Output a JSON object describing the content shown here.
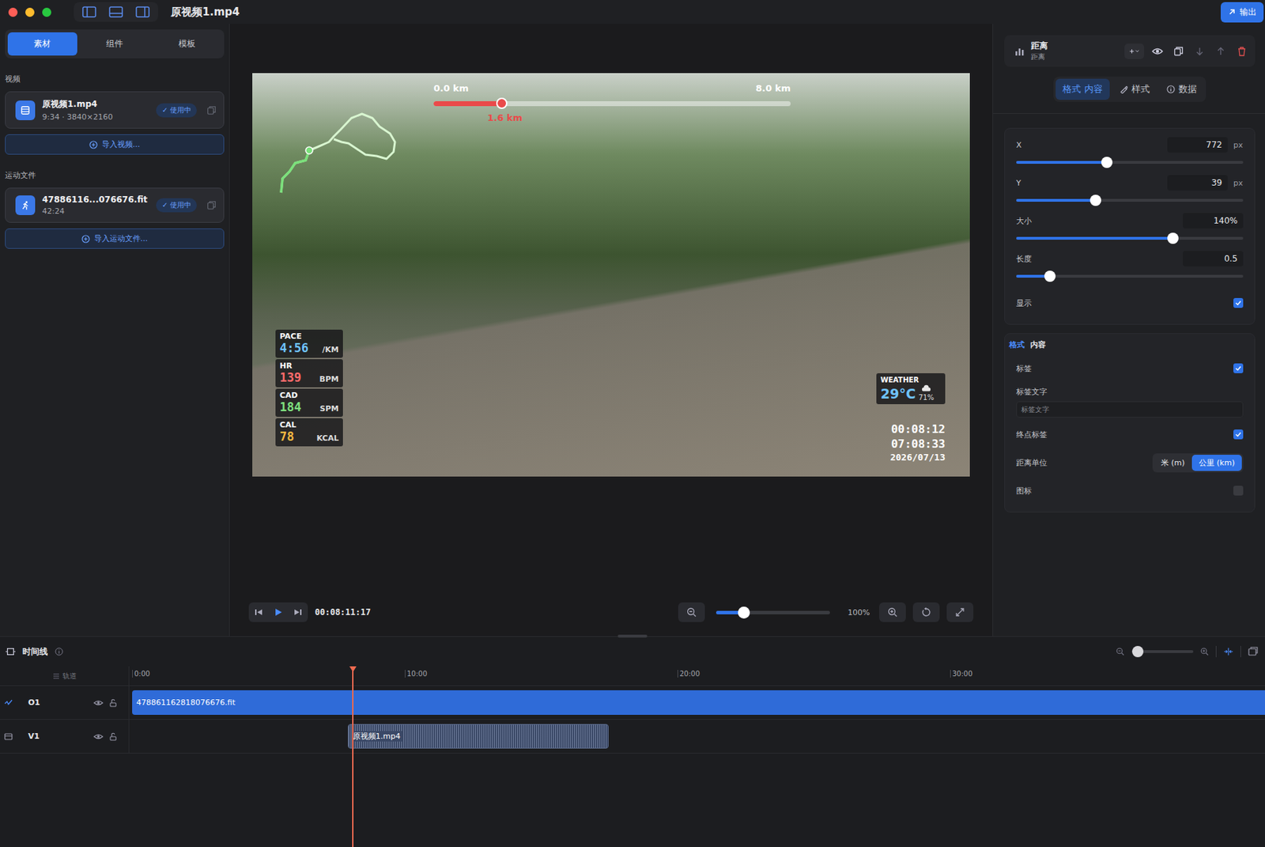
{
  "window": {
    "title": "原视频1.mp4",
    "export": "输出"
  },
  "left_panel": {
    "tabs": [
      {
        "label": "素材",
        "selected": true
      },
      {
        "label": "组件",
        "selected": false
      },
      {
        "label": "模板",
        "selected": false
      }
    ],
    "sections": [
      {
        "title": "视频",
        "kind": "video",
        "items": [
          {
            "name": "原视频1.mp4",
            "meta": "9:34 · 3840×2160",
            "badge": "✓ 使用中"
          }
        ],
        "import": "导入视频..."
      },
      {
        "title": "运动文件",
        "kind": "activity",
        "items": [
          {
            "name": "47886116...076676.fit",
            "meta": "42:24",
            "badge": "✓ 使用中"
          }
        ],
        "import": "导入运动文件..."
      }
    ]
  },
  "preview": {
    "distance": {
      "start": "0.0 km",
      "end": "8.0 km",
      "current": "1.6 km",
      "level": 0.19
    },
    "metrics": [
      {
        "label": "PACE",
        "value": "4:56",
        "unit": "/KM",
        "color": "#6fc3ff"
      },
      {
        "label": "HR",
        "value": "139",
        "unit": "BPM",
        "color": "#ff6b6b"
      },
      {
        "label": "CAD",
        "value": "184",
        "unit": "SPM",
        "color": "#7fe07f"
      },
      {
        "label": "CAL",
        "value": "78",
        "unit": "KCAL",
        "color": "#f5b942"
      }
    ],
    "weather": {
      "label": "WEATHER",
      "temp": "29°C",
      "humidity": "71%"
    },
    "clock": [
      "00:08:12",
      "07:08:33",
      "2026/07/13"
    ]
  },
  "playback": {
    "timecode": "00:08:11:17",
    "zoom_level": 0.24,
    "zoom": "100%"
  },
  "inspector": {
    "title": "距离",
    "subtitle": "距离",
    "tabs": [
      {
        "label": "格式 内容",
        "selected": true
      },
      {
        "label": "样式",
        "selected": false
      },
      {
        "label": "数据",
        "selected": false
      }
    ],
    "sliders": [
      {
        "label": "X",
        "value": "772",
        "unit": "px",
        "level": 0.4
      },
      {
        "label": "Y",
        "value": "39",
        "unit": "px",
        "level": 0.35
      },
      {
        "label": "大小",
        "value": "140%",
        "unit": "",
        "level": 0.69
      },
      {
        "label": "长度",
        "value": "0.5",
        "unit": "",
        "level": 0.15
      }
    ],
    "show": {
      "label": "显示",
      "checked": true
    },
    "sub_tabs": [
      {
        "label": "格式",
        "selected": true
      },
      {
        "label": "内容",
        "selected": false
      }
    ],
    "fields": [
      {
        "kind": "checkbox",
        "label": "标签",
        "checked": true
      },
      {
        "kind": "text",
        "label": "标签文字",
        "placeholder": "标签文字"
      },
      {
        "kind": "checkbox",
        "label": "终点标签",
        "checked": true
      },
      {
        "kind": "segmented",
        "label": "距离单位",
        "options": [
          {
            "label": "米 (m)",
            "selected": false
          },
          {
            "label": "公里 (km)",
            "selected": true
          }
        ]
      },
      {
        "kind": "checkbox",
        "label": "图标",
        "checked": false
      }
    ]
  },
  "timeline": {
    "title": "时间线",
    "track_header": "轨道",
    "zoom_level": 0.1,
    "ticks": [
      "0:00",
      "10:00",
      "20:00",
      "30:00"
    ],
    "tick_step_min": 10,
    "playhead_min": 8.1,
    "tracks": [
      {
        "name": "O1",
        "kind": "activity",
        "clip": "478861162818076676.fit",
        "start_min": 0,
        "length_min": 42.4,
        "color": "#2f6bd8"
      },
      {
        "name": "V1",
        "kind": "video",
        "clip": "原视频1.mp4",
        "start_min": 7.9,
        "length_min": 9.57,
        "color": "#3a4866"
      }
    ]
  }
}
